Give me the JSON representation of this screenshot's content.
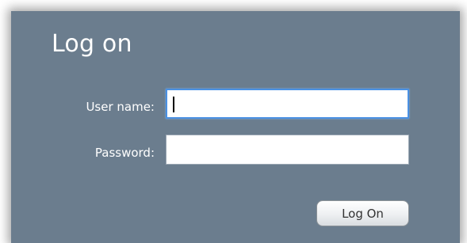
{
  "dialog": {
    "title": "Log on"
  },
  "form": {
    "username_label": "User name:",
    "username_value": "",
    "password_label": "Password:",
    "password_value": "",
    "submit_label": "Log On"
  },
  "colors": {
    "panel_background": "#6b7d8e",
    "text": "#ffffff",
    "focus_border": "#4a90e2"
  }
}
